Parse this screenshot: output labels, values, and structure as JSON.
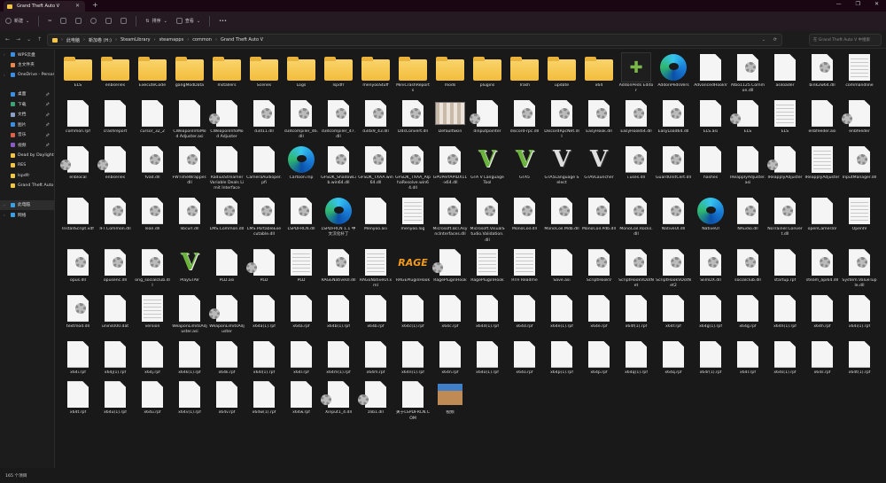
{
  "window": {
    "tab_title": "Grand Theft Auto V",
    "new_tab": "+",
    "minimize": "—",
    "maximize": "❐",
    "close": "✕"
  },
  "toolbar": {
    "new_label": "新建",
    "sort_label": "排序",
    "view_label": "查看",
    "more": "•••"
  },
  "address": {
    "crumbs": [
      "此电脑",
      "新加卷 (H:)",
      "SteamLibrary",
      "steamapps",
      "common",
      "Grand Theft Auto V"
    ],
    "search_placeholder": "在 Grand Theft Auto V 中搜索"
  },
  "sidebar": {
    "items": [
      {
        "label": "WPS云盘",
        "icon": "cloud",
        "color": "#3a8ee6",
        "arrow": true
      },
      {
        "label": "主文件夹",
        "icon": "home",
        "color": "#e8894a"
      },
      {
        "label": "OneDrive - Personal",
        "icon": "cloud",
        "color": "#3a8ee6",
        "arrow": true
      },
      {
        "label": "桌面",
        "icon": "desktop",
        "color": "#3a8ee6",
        "pin": true,
        "gap": true
      },
      {
        "label": "下载",
        "icon": "download",
        "color": "#3ca374",
        "pin": true
      },
      {
        "label": "文档",
        "icon": "document",
        "color": "#8aa0c8",
        "pin": true
      },
      {
        "label": "图片",
        "icon": "pictures",
        "color": "#3a8ee6",
        "pin": true
      },
      {
        "label": "音乐",
        "icon": "music",
        "color": "#e0604a",
        "pin": true
      },
      {
        "label": "视频",
        "icon": "video",
        "color": "#8a5ac8",
        "pin": true
      },
      {
        "label": "Dead by Daylight",
        "icon": "folder",
        "color": "#f4c542"
      },
      {
        "label": "RES",
        "icon": "folder",
        "color": "#f4c542"
      },
      {
        "label": "lspdfr",
        "icon": "folder",
        "color": "#f4c542"
      },
      {
        "label": "Grand Theft Auto V",
        "icon": "folder",
        "color": "#f4c542"
      },
      {
        "label": "此电脑",
        "icon": "computer",
        "color": "#3aa0e6",
        "arrow": true,
        "selected": true,
        "gap": true
      },
      {
        "label": "网络",
        "icon": "network",
        "color": "#3aa0e6",
        "arrow": true
      }
    ]
  },
  "items": [
    {
      "name": "ELS",
      "icon": "folder"
    },
    {
      "name": "enbseries",
      "icon": "folder"
    },
    {
      "name": "ExecuteCode",
      "icon": "folder"
    },
    {
      "name": "gangModData",
      "icon": "folder"
    },
    {
      "name": "Installers",
      "icon": "folder"
    },
    {
      "name": "Scenes",
      "icon": "folder"
    },
    {
      "name": "Logs",
      "icon": "folder"
    },
    {
      "name": "lspdfr",
      "icon": "folder"
    },
    {
      "name": "menyooStuff",
      "icon": "folder"
    },
    {
      "name": "MiniCrashReports",
      "icon": "folder"
    },
    {
      "name": "mods",
      "icon": "folder"
    },
    {
      "name": "plugins",
      "icon": "folder"
    },
    {
      "name": "Trash",
      "icon": "folder"
    },
    {
      "name": "update",
      "icon": "folder"
    },
    {
      "name": "x64",
      "icon": "folder"
    },
    {
      "name": "AddonPeds Editor",
      "icon": "puzzle"
    },
    {
      "name": "AddonPedsVers",
      "icon": "edge"
    },
    {
      "name": "AdvancedHookV",
      "icon": "file"
    },
    {
      "name": "Albo1125.Common.dll",
      "icon": "gear"
    },
    {
      "name": "asiloader",
      "icon": "file"
    },
    {
      "name": "bink2w64.dll",
      "icon": "gear"
    },
    {
      "name": "commandline",
      "icon": "text"
    },
    {
      "name": "common.rpf",
      "icon": "file"
    },
    {
      "name": "crashreport",
      "icon": "file"
    },
    {
      "name": "cursor_32_2",
      "icon": "file"
    },
    {
      "name": "CWeaponInfoMod Adjuster.asi",
      "icon": "file"
    },
    {
      "name": "CWeaponInfoMod Adjuster",
      "icon": "gearleft"
    },
    {
      "name": "d3d11.dll",
      "icon": "gear"
    },
    {
      "name": "d3dcompiler_46.dll",
      "icon": "gear"
    },
    {
      "name": "d3dcompiler_47.dll",
      "icon": "gear"
    },
    {
      "name": "d3dx9_43.dll",
      "icon": "gear"
    },
    {
      "name": "DdsConvert.dll",
      "icon": "gear"
    },
    {
      "name": "DefaultSkin",
      "icon": "image"
    },
    {
      "name": "dinputpointer",
      "icon": "gearleft"
    },
    {
      "name": "discord-rpc.dll",
      "icon": "gear"
    },
    {
      "name": "DiscordRpcNet.dll",
      "icon": "gear"
    },
    {
      "name": "EasyHook.dll",
      "icon": "gear"
    },
    {
      "name": "EasyHook64.dll",
      "icon": "gear"
    },
    {
      "name": "EasyLoad64.dll",
      "icon": "gear"
    },
    {
      "name": "ELS.asi",
      "icon": "file"
    },
    {
      "name": "ELS",
      "icon": "gearleft"
    },
    {
      "name": "ELS",
      "icon": "text"
    },
    {
      "name": "enbfeeder.asi",
      "icon": "file"
    },
    {
      "name": "enbfeeder",
      "icon": "gearleft"
    },
    {
      "name": "enblocal",
      "icon": "gearleft"
    },
    {
      "name": "enbseries",
      "icon": "gearleft"
    },
    {
      "name": "fvad.dll",
      "icon": "gear"
    },
    {
      "name": "FWTimeWrapper.dll",
      "icon": "gear"
    },
    {
      "name": "RadiusStreamer Variable Deals Limit Interface",
      "icon": "file"
    },
    {
      "name": "CameraAudioper.pfi",
      "icon": "file"
    },
    {
      "name": "Cartoon.lnp",
      "icon": "edge"
    },
    {
      "name": "GFSDK_ShadowLib.win64.dll",
      "icon": "gear"
    },
    {
      "name": "GFSDK_TXAA.win64.dll",
      "icon": "gear"
    },
    {
      "name": "GFSDK_TXAA_AlphaResolve.win64.dll",
      "icon": "gear"
    },
    {
      "name": "GPUPerfAPIDX11-x64.dll",
      "icon": "gear"
    },
    {
      "name": "GTA V Language Tool",
      "icon": "gta"
    },
    {
      "name": "GTA5",
      "icon": "gta"
    },
    {
      "name": "GTA5Language Select",
      "icon": "gtabw"
    },
    {
      "name": "GTAVLauncher",
      "icon": "gtabw"
    },
    {
      "name": "i.uses.dll",
      "icon": "gear"
    },
    {
      "name": "GuardUnitCert.dll",
      "icon": "gear"
    },
    {
      "name": "hashes",
      "icon": "file"
    },
    {
      "name": "IReapplyAdjuster.asi",
      "icon": "file"
    },
    {
      "name": "IReapplyAdjuster",
      "icon": "gearleft"
    },
    {
      "name": "IReapplyAdjuster",
      "icon": "text"
    },
    {
      "name": "InputManager.dll",
      "icon": "gear"
    },
    {
      "name": "InstallScript.vdf",
      "icon": "file"
    },
    {
      "name": "IFT.Common.dll",
      "icon": "gear"
    },
    {
      "name": "lean.dll",
      "icon": "gear"
    },
    {
      "name": "libcurl.dll",
      "icon": "gear"
    },
    {
      "name": "LMS.Common.dll",
      "icon": "gear"
    },
    {
      "name": "LMS.PortableExecutable.dll",
      "icon": "gear"
    },
    {
      "name": "LSPDFRCN.dll",
      "icon": "gear"
    },
    {
      "name": "LSPDFRCN 1.1 中文汉化补丁",
      "icon": "edge"
    },
    {
      "name": "Menyoo.asi",
      "icon": "file"
    },
    {
      "name": "menyoo.log",
      "icon": "text"
    },
    {
      "name": "Microsoft.Bcl.AsyncInterfaces.dll",
      "icon": "gear"
    },
    {
      "name": "Microsoft.VisualStudio.Validation.dll",
      "icon": "gear"
    },
    {
      "name": "MonoCoil.dll",
      "icon": "gear"
    },
    {
      "name": "MonoCoil.Mdb.dll",
      "icon": "gear"
    },
    {
      "name": "MonoCoil.Pdb.dll",
      "icon": "gear"
    },
    {
      "name": "MonoCoil.Rocks.dll",
      "icon": "gear"
    },
    {
      "name": "NativeUI.dll",
      "icon": "gear"
    },
    {
      "name": "NativeUI",
      "icon": "edge"
    },
    {
      "name": "NAudio.dll",
      "icon": "gear"
    },
    {
      "name": "NoTrainer.Convert.dll",
      "icon": "gear"
    },
    {
      "name": "openCameraV",
      "icon": "file"
    },
    {
      "name": "OpenIV",
      "icon": "text"
    },
    {
      "name": "opus.dll",
      "icon": "gear"
    },
    {
      "name": "opusenc.dll",
      "icon": "gear"
    },
    {
      "name": "orig_socialclub.dll",
      "icon": "gear"
    },
    {
      "name": "PlayGTAV",
      "icon": "gta"
    },
    {
      "name": "PLD.asi",
      "icon": "file"
    },
    {
      "name": "PLD",
      "icon": "gearleft"
    },
    {
      "name": "PLD",
      "icon": "text"
    },
    {
      "name": "RAGENativeUI.dll",
      "icon": "gear"
    },
    {
      "name": "RAGENativeUI.xml",
      "icon": "text"
    },
    {
      "name": "RAGEPluginHook",
      "icon": "rage"
    },
    {
      "name": "RagePluginHook",
      "icon": "gearleft"
    },
    {
      "name": "RagePluginHook",
      "icon": "text"
    },
    {
      "name": "RTH Readme",
      "icon": "text"
    },
    {
      "name": "Save.asi",
      "icon": "file"
    },
    {
      "name": "ScriptHookV",
      "icon": "gear"
    },
    {
      "name": "ScriptHookVDotNet",
      "icon": "gear"
    },
    {
      "name": "ScriptHookVDotNet2",
      "icon": "gear"
    },
    {
      "name": "SlimDX.dll",
      "icon": "gear"
    },
    {
      "name": "socialclub.dll",
      "icon": "gear"
    },
    {
      "name": "startup.rpf",
      "icon": "file"
    },
    {
      "name": "steam_api64.dll",
      "icon": "gear"
    },
    {
      "name": "System.ValueTuple.dll",
      "icon": "gear"
    },
    {
      "name": "textmod.dll",
      "icon": "gear"
    },
    {
      "name": "unins000.dat",
      "icon": "file"
    },
    {
      "name": "version",
      "icon": "text"
    },
    {
      "name": "WeaponLimitsAdjuster.asi",
      "icon": "file"
    },
    {
      "name": "WeaponLimitsAdjuster",
      "icon": "gearleft"
    },
    {
      "name": "x64a(1).rpf",
      "icon": "file"
    },
    {
      "name": "x64a.rpf",
      "icon": "file"
    },
    {
      "name": "x64b(1).rpf",
      "icon": "file"
    },
    {
      "name": "x64b.rpf",
      "icon": "file"
    },
    {
      "name": "x64c(1).rpf",
      "icon": "file"
    },
    {
      "name": "x64c.rpf",
      "icon": "file"
    },
    {
      "name": "x64d(1).rpf",
      "icon": "file"
    },
    {
      "name": "x64d.rpf",
      "icon": "file"
    },
    {
      "name": "x64e(1).rpf",
      "icon": "file"
    },
    {
      "name": "x64e.rpf",
      "icon": "file"
    },
    {
      "name": "x64f(1).rpf",
      "icon": "file"
    },
    {
      "name": "x64f.rpf",
      "icon": "file"
    },
    {
      "name": "x64g(1).rpf",
      "icon": "file"
    },
    {
      "name": "x64g.rpf",
      "icon": "file"
    },
    {
      "name": "x64h(1).rpf",
      "icon": "file"
    },
    {
      "name": "x64h.rpf",
      "icon": "file"
    },
    {
      "name": "x64i(1).rpf",
      "icon": "file"
    },
    {
      "name": "x64i.rpf",
      "icon": "file"
    },
    {
      "name": "x64j(1).rpf",
      "icon": "file"
    },
    {
      "name": "x64j.rpf",
      "icon": "file"
    },
    {
      "name": "x64k(1).rpf",
      "icon": "file"
    },
    {
      "name": "x64k.rpf",
      "icon": "file"
    },
    {
      "name": "x64l(1).rpf",
      "icon": "file"
    },
    {
      "name": "x64l.rpf",
      "icon": "file"
    },
    {
      "name": "x64m(1).rpf",
      "icon": "file"
    },
    {
      "name": "x64m.rpf",
      "icon": "file"
    },
    {
      "name": "x64n(1).rpf",
      "icon": "file"
    },
    {
      "name": "x64n.rpf",
      "icon": "file"
    },
    {
      "name": "x64o(1).rpf",
      "icon": "file"
    },
    {
      "name": "x64o.rpf",
      "icon": "file"
    },
    {
      "name": "x64p(1).rpf",
      "icon": "file"
    },
    {
      "name": "x64p.rpf",
      "icon": "file"
    },
    {
      "name": "x64q(1).rpf",
      "icon": "file"
    },
    {
      "name": "x64q.rpf",
      "icon": "file"
    },
    {
      "name": "x64r(1).rpf",
      "icon": "file"
    },
    {
      "name": "x64r.rpf",
      "icon": "file"
    },
    {
      "name": "x64s(1).rpf",
      "icon": "file"
    },
    {
      "name": "x64s.rpf",
      "icon": "file"
    },
    {
      "name": "x64t(1).rpf",
      "icon": "file"
    },
    {
      "name": "x64t.rpf",
      "icon": "file"
    },
    {
      "name": "x64u(1).rpf",
      "icon": "file"
    },
    {
      "name": "x64u.rpf",
      "icon": "file"
    },
    {
      "name": "x64v(1).rpf",
      "icon": "file"
    },
    {
      "name": "x64v.rpf",
      "icon": "file"
    },
    {
      "name": "x64w(1).rpf",
      "icon": "file"
    },
    {
      "name": "x64w.rpf",
      "icon": "file"
    },
    {
      "name": "Xinput1_4.dll",
      "icon": "gearleft"
    },
    {
      "name": "zlib1.dll",
      "icon": "gearleft"
    },
    {
      "name": "关于LSPDFRCN.COM",
      "icon": "file"
    },
    {
      "name": "视频",
      "icon": "box"
    }
  ],
  "status": {
    "count": "165 个项目"
  }
}
